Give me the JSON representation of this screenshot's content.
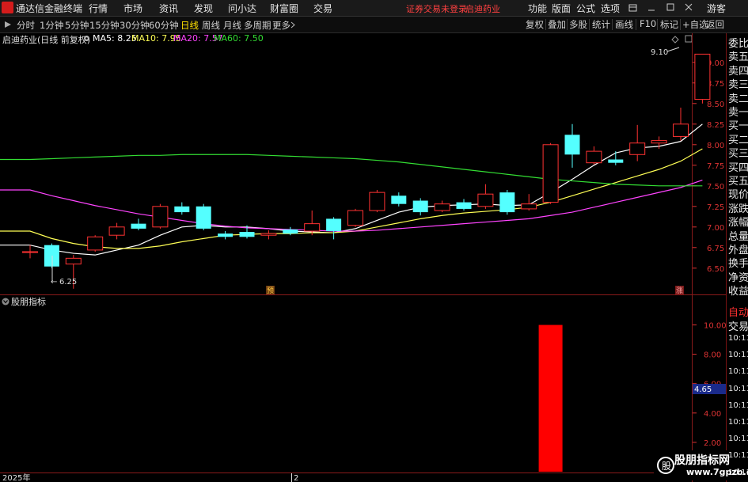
{
  "titlebar": {
    "app_name": "通达信金融终端",
    "menu": [
      "行情",
      "市场",
      "资讯",
      "发现",
      "问小达",
      "财富圈",
      "交易"
    ],
    "notice": "证券交易未登录",
    "stock": "启迪药业",
    "right_menu": [
      "功能",
      "版面",
      "公式",
      "选项"
    ],
    "guest": "游客",
    "window_controls": [
      "minimize-icon",
      "maximize-icon",
      "close-icon"
    ]
  },
  "toolbar": {
    "periods": [
      "分时",
      "1分钟",
      "5分钟",
      "15分钟",
      "30分钟",
      "60分钟",
      "日线",
      "周线",
      "月线",
      "多周期",
      "更多"
    ],
    "active_period": "日线",
    "right_buttons": [
      "复权",
      "叠加",
      "多股",
      "统计",
      "画线",
      "F10",
      "标记",
      "+自选",
      "返回"
    ]
  },
  "infoline": {
    "label": "启迪药业(日线 前复权)",
    "ma": [
      {
        "name": "MA5:",
        "value": "8.25",
        "color": "#ffffff"
      },
      {
        "name": "MA10:",
        "value": "7.95",
        "color": "#ffff55"
      },
      {
        "name": "MA20:",
        "value": "7.57",
        "color": "#ff44ff"
      },
      {
        "name": "MA60:",
        "value": "7.50",
        "color": "#33dd33"
      }
    ]
  },
  "right_panel": {
    "items": [
      "委比",
      "卖五",
      "卖四",
      "卖三",
      "卖二",
      "卖一",
      "买一",
      "买二",
      "买三",
      "买四",
      "买五",
      "现价",
      "涨跌",
      "涨幅",
      "总量",
      "外盘",
      "换手",
      "净资",
      "收益"
    ],
    "lower_items": [
      "自动",
      "交易"
    ],
    "times": [
      "10:11",
      "10:11",
      "10:11",
      "10:11",
      "10:11",
      "10:11",
      "10:11",
      "10:11",
      "10:11"
    ]
  },
  "indicator": {
    "name": "股朋指标",
    "yaxis_labels": [
      "10.00",
      "8.00",
      "6.00",
      "4.00",
      "2.00"
    ],
    "ylim": [
      0,
      11
    ],
    "current_value": "4.65",
    "bar_value": 10.0,
    "bar_index": 24
  },
  "xaxis": {
    "labels": [
      "2025年",
      "2"
    ]
  },
  "watermark": {
    "line1": "股朋指标网",
    "line2": "www.7gpzb.com"
  },
  "chart_data": {
    "type": "candlestick",
    "ylim": [
      6.2,
      9.2
    ],
    "yaxis_labels": [
      "9.00",
      "8.75",
      "8.50",
      "8.25",
      "8.00",
      "7.75",
      "7.50",
      "7.25",
      "7.00",
      "6.75",
      "6.50"
    ],
    "annotations": {
      "high": "9.10",
      "low": "6.25",
      "markers": [
        "预",
        "涨"
      ]
    },
    "candles": [
      {
        "o": 6.7,
        "c": 6.7,
        "h": 6.78,
        "l": 6.62
      },
      {
        "o": 6.78,
        "c": 6.52,
        "h": 6.8,
        "l": 6.5
      },
      {
        "o": 6.55,
        "c": 6.62,
        "h": 6.66,
        "l": 6.25
      },
      {
        "o": 6.72,
        "c": 6.88,
        "h": 6.9,
        "l": 6.7
      },
      {
        "o": 6.9,
        "c": 7.0,
        "h": 7.05,
        "l": 6.85
      },
      {
        "o": 7.04,
        "c": 6.98,
        "h": 7.1,
        "l": 6.96
      },
      {
        "o": 7.0,
        "c": 7.25,
        "h": 7.28,
        "l": 6.98
      },
      {
        "o": 7.25,
        "c": 7.18,
        "h": 7.3,
        "l": 7.15
      },
      {
        "o": 7.25,
        "c": 6.98,
        "h": 7.28,
        "l": 6.96
      },
      {
        "o": 6.92,
        "c": 6.88,
        "h": 6.95,
        "l": 6.85
      },
      {
        "o": 6.94,
        "c": 6.88,
        "h": 7.02,
        "l": 6.86
      },
      {
        "o": 6.9,
        "c": 6.92,
        "h": 6.96,
        "l": 6.85
      },
      {
        "o": 6.97,
        "c": 6.92,
        "h": 7.0,
        "l": 6.9
      },
      {
        "o": 6.95,
        "c": 7.04,
        "h": 7.2,
        "l": 6.9
      },
      {
        "o": 7.1,
        "c": 6.95,
        "h": 7.12,
        "l": 6.85
      },
      {
        "o": 7.02,
        "c": 7.2,
        "h": 7.22,
        "l": 7.0
      },
      {
        "o": 7.2,
        "c": 7.42,
        "h": 7.45,
        "l": 7.18
      },
      {
        "o": 7.38,
        "c": 7.28,
        "h": 7.42,
        "l": 7.25
      },
      {
        "o": 7.32,
        "c": 7.18,
        "h": 7.35,
        "l": 7.14
      },
      {
        "o": 7.2,
        "c": 7.28,
        "h": 7.32,
        "l": 7.18
      },
      {
        "o": 7.3,
        "c": 7.22,
        "h": 7.34,
        "l": 7.2
      },
      {
        "o": 7.25,
        "c": 7.4,
        "h": 7.52,
        "l": 7.22
      },
      {
        "o": 7.42,
        "c": 7.18,
        "h": 7.45,
        "l": 7.15
      },
      {
        "o": 7.22,
        "c": 7.28,
        "h": 7.4,
        "l": 7.2
      },
      {
        "o": 7.3,
        "c": 8.0,
        "h": 8.02,
        "l": 7.28
      },
      {
        "o": 8.12,
        "c": 7.88,
        "h": 8.25,
        "l": 7.72
      },
      {
        "o": 7.78,
        "c": 7.92,
        "h": 7.98,
        "l": 7.76
      },
      {
        "o": 7.82,
        "c": 7.78,
        "h": 7.92,
        "l": 7.75
      },
      {
        "o": 7.88,
        "c": 8.02,
        "h": 8.24,
        "l": 7.8
      },
      {
        "o": 8.02,
        "c": 8.05,
        "h": 8.1,
        "l": 7.95
      },
      {
        "o": 8.1,
        "c": 8.25,
        "h": 8.45,
        "l": 8.05
      },
      {
        "o": 8.55,
        "c": 9.1,
        "h": 9.1,
        "l": 8.5
      }
    ],
    "series": [
      {
        "name": "MA5",
        "color": "#ffffff",
        "values": [
          6.78,
          6.72,
          6.68,
          6.66,
          6.72,
          6.78,
          6.9,
          7.0,
          7.02,
          7.0,
          7.0,
          6.98,
          6.95,
          6.94,
          6.93,
          6.98,
          7.08,
          7.18,
          7.24,
          7.26,
          7.27,
          7.28,
          7.26,
          7.27,
          7.42,
          7.58,
          7.75,
          7.9,
          7.96,
          7.98,
          8.04,
          8.25
        ]
      },
      {
        "name": "MA10",
        "color": "#ffff55",
        "values": [
          6.95,
          6.86,
          6.8,
          6.76,
          6.74,
          6.74,
          6.77,
          6.82,
          6.86,
          6.9,
          6.91,
          6.92,
          6.92,
          6.93,
          6.93,
          6.95,
          7.0,
          7.05,
          7.1,
          7.14,
          7.17,
          7.19,
          7.21,
          7.24,
          7.3,
          7.38,
          7.46,
          7.54,
          7.62,
          7.7,
          7.8,
          7.95
        ]
      },
      {
        "name": "MA20",
        "color": "#ff44ff",
        "values": [
          7.45,
          7.38,
          7.32,
          7.26,
          7.21,
          7.16,
          7.12,
          7.08,
          7.04,
          7.01,
          6.99,
          6.98,
          6.97,
          6.96,
          6.95,
          6.95,
          6.96,
          6.98,
          7.0,
          7.02,
          7.04,
          7.06,
          7.08,
          7.1,
          7.14,
          7.18,
          7.24,
          7.3,
          7.36,
          7.42,
          7.48,
          7.57
        ]
      },
      {
        "name": "MA60",
        "color": "#33dd33",
        "values": [
          7.82,
          7.83,
          7.84,
          7.85,
          7.86,
          7.87,
          7.87,
          7.88,
          7.88,
          7.88,
          7.88,
          7.87,
          7.86,
          7.85,
          7.84,
          7.83,
          7.81,
          7.79,
          7.76,
          7.73,
          7.7,
          7.67,
          7.64,
          7.61,
          7.58,
          7.56,
          7.54,
          7.52,
          7.51,
          7.5,
          7.5,
          7.5
        ]
      }
    ]
  }
}
